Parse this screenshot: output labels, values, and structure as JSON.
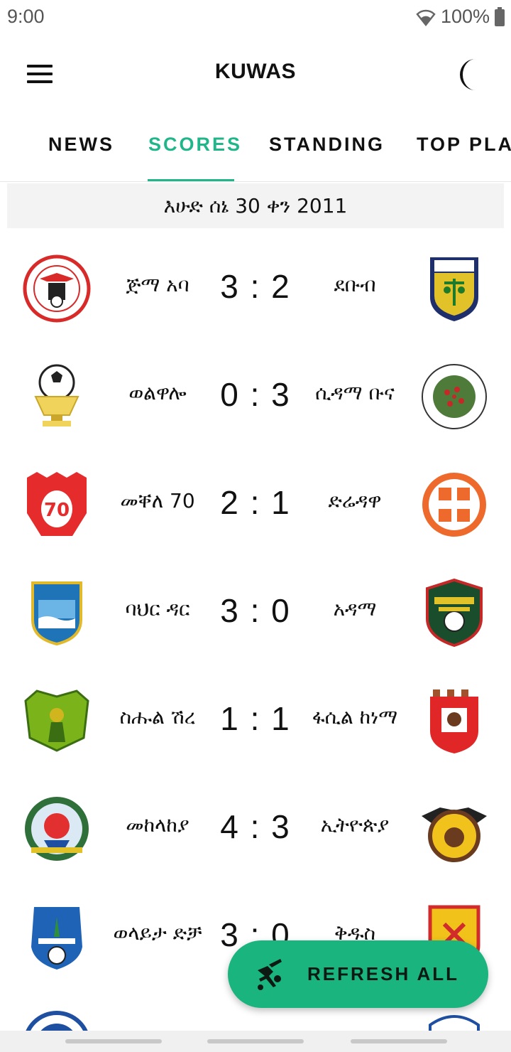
{
  "status": {
    "time": "9:00",
    "battery": "100%"
  },
  "app": {
    "title": "KUWAS"
  },
  "tabs": [
    {
      "label": "NEWS",
      "active": false
    },
    {
      "label": "SCORES",
      "active": true
    },
    {
      "label": "STANDING",
      "active": false
    },
    {
      "label": "TOP PLA",
      "active": false
    }
  ],
  "date_header": "እሁድ ሰኔ 30 ቀን 2011",
  "matches": [
    {
      "home": "ጅማ አባ",
      "score": "3 : 2",
      "away": "ደቡብ"
    },
    {
      "home": "ወልዋሎ",
      "score": "0 : 3",
      "away": "ሲዳማ ቡና"
    },
    {
      "home": "መቐለ 70",
      "score": "2 : 1",
      "away": "ድሬዳዋ"
    },
    {
      "home": "ባህር ዳር",
      "score": "3 : 0",
      "away": "አዳማ"
    },
    {
      "home": "ስሑል ሽረ",
      "score": "1 : 1",
      "away": "ፋሲል ከነማ"
    },
    {
      "home": "መከላከያ",
      "score": "4 : 3",
      "away": "ኢትዮጵያ"
    },
    {
      "home": "ወላይታ ድቻ",
      "score": "3 : 0",
      "away": "ቅዱስ"
    },
    {
      "home": "",
      "score": "",
      "away": ""
    }
  ],
  "fab": {
    "label": "REFRESH ALL"
  },
  "colors": {
    "accent": "#20b58a",
    "fab": "#1ab47e"
  }
}
